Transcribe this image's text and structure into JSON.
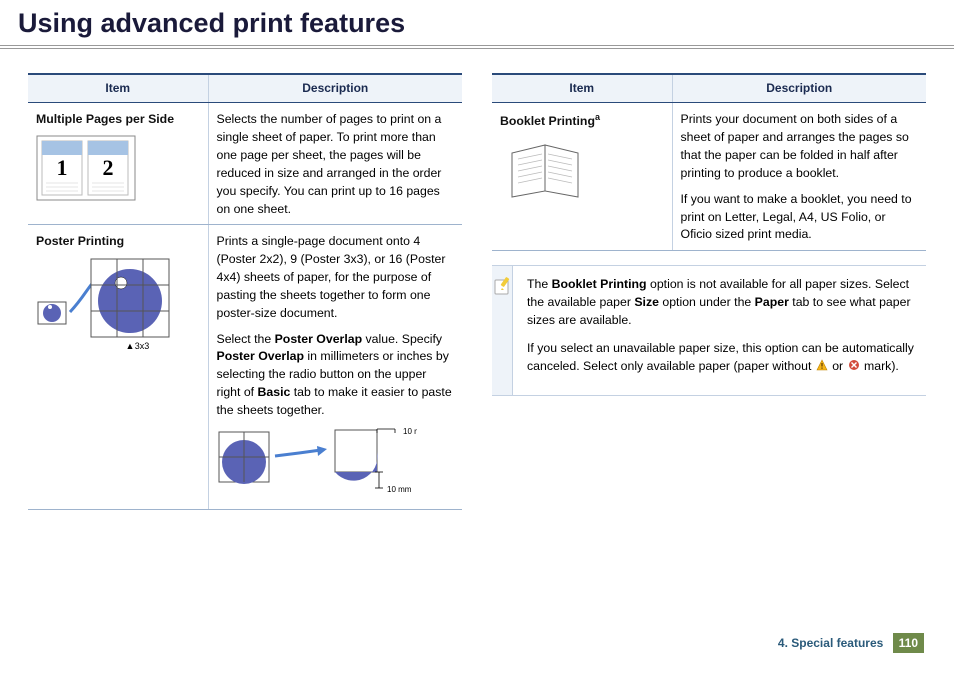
{
  "page": {
    "title": "Using advanced print features",
    "breadcrumb": "4.  Special features",
    "page_number": "110"
  },
  "left": {
    "headers": {
      "item": "Item",
      "desc": "Description"
    },
    "rows": [
      {
        "name": "Multiple Pages per Side",
        "desc_p1": "Selects the number of pages to print on a single sheet of paper. To print more than one page per sheet, the pages will be reduced in size and arranged in the order you specify. You can print up to 16 pages on one sheet."
      },
      {
        "name": "Poster Printing",
        "grid_label": "3x3",
        "desc_p1": "Prints a single-page document onto 4 (Poster 2x2), 9 (Poster 3x3), or 16 (Poster 4x4) sheets of paper, for the purpose of pasting the sheets together to form one poster-size document.",
        "desc_p2_a": "Select the ",
        "desc_p2_b": "Poster Overlap",
        "desc_p2_c": " value. Specify ",
        "desc_p2_d": "Poster Overlap",
        "desc_p2_e": " in millimeters or inches by selecting the radio button on the upper right of ",
        "desc_p2_f": "Basic",
        "desc_p2_g": " tab to make it easier to paste the sheets together.",
        "overlap_label": "10 mm"
      }
    ]
  },
  "right": {
    "headers": {
      "item": "Item",
      "desc": "Description"
    },
    "rows": [
      {
        "name": "Booklet Printing",
        "fn": "a",
        "desc_p1": "Prints your document on both sides of a sheet of paper and arranges the pages so that the paper can be folded in half after printing to produce a booklet.",
        "desc_p2": "If you want to make a booklet, you need to print on Letter, Legal, A4, US Folio, or Oficio sized print media."
      }
    ],
    "note": {
      "p1_a": "The ",
      "p1_b": "Booklet Printing",
      "p1_c": " option is not available for all paper sizes. Select the available paper ",
      "p1_d": "Size",
      "p1_e": " option under the ",
      "p1_f": "Paper",
      "p1_g": " tab to see what paper sizes are available.",
      "p2_a": "If you select an unavailable paper size, this option can be automatically canceled. Select only available paper (paper without ",
      "p2_b": " or ",
      "p2_c": " mark)."
    }
  }
}
